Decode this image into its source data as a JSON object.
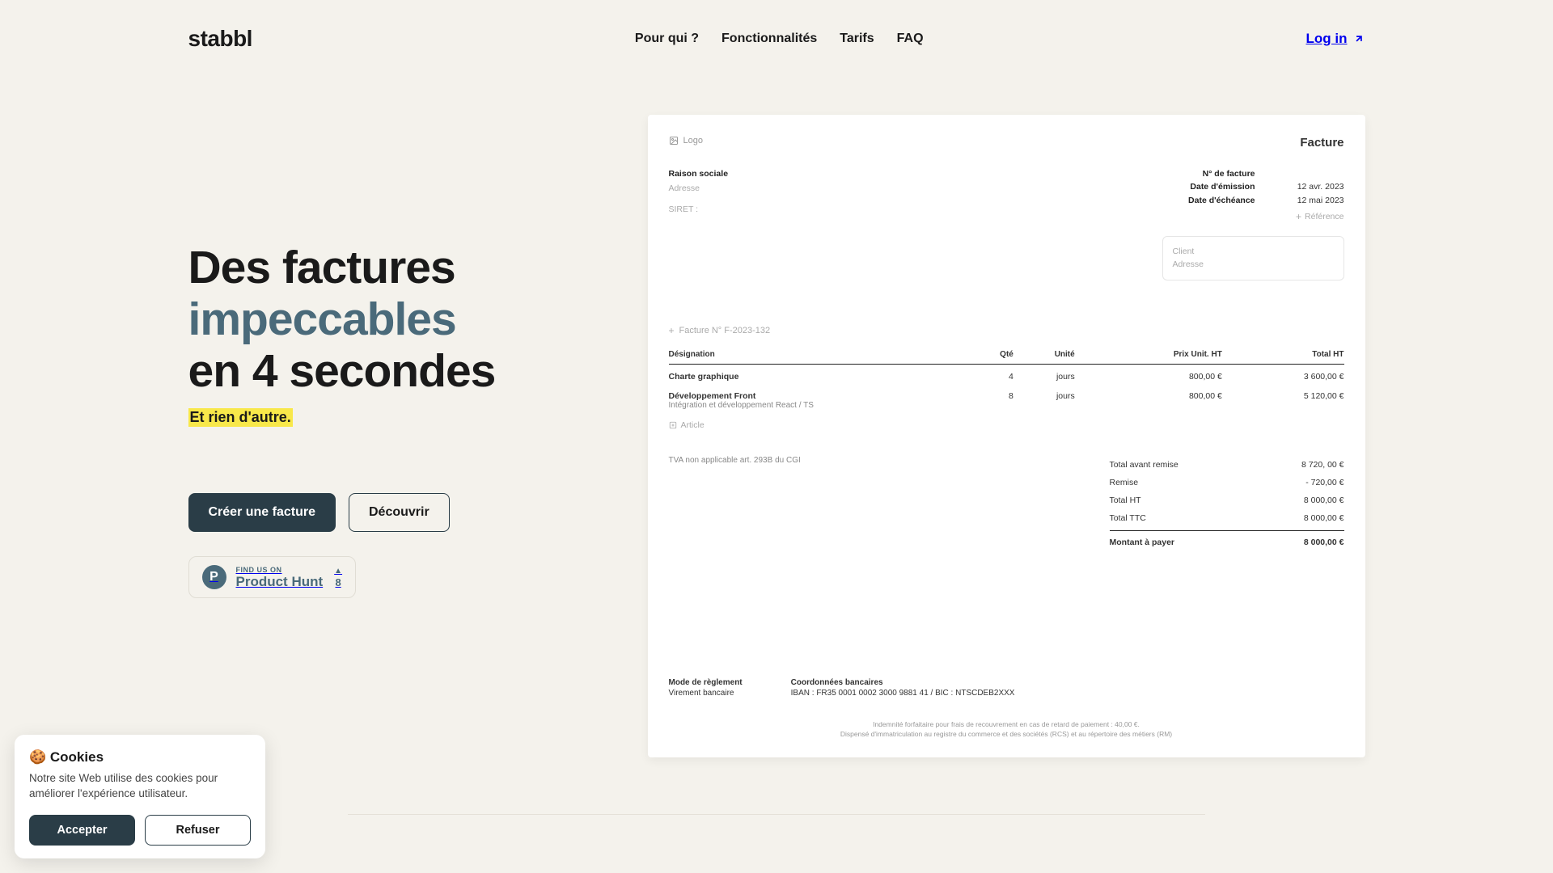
{
  "brand": "stabbl",
  "nav": {
    "pour_qui": "Pour qui ?",
    "fonctionnalites": "Fonctionnalités",
    "tarifs": "Tarifs",
    "faq": "FAQ"
  },
  "login": "Log in",
  "hero": {
    "line1": "Des factures",
    "line2": "impeccables",
    "line3": "en 4 secondes",
    "tagline": "Et rien d'autre.",
    "cta_primary": "Créer une facture",
    "cta_secondary": "Découvrir"
  },
  "ph": {
    "find_us": "FIND US ON",
    "name": "Product Hunt",
    "count": "8"
  },
  "invoice": {
    "logo_label": "Logo",
    "title": "Facture",
    "from": {
      "company": "Raison sociale",
      "address": "Adresse",
      "siret": "SIRET :"
    },
    "dates": {
      "num_label": "N° de facture",
      "issue_label": "Date d'émission",
      "issue_val": "12 avr. 2023",
      "due_label": "Date d'échéance",
      "due_val": "12 mai 2023",
      "ref": "Référence"
    },
    "client": {
      "label": "Client",
      "address": "Adresse"
    },
    "number": "Facture N° F-2023-132",
    "cols": {
      "design": "Désignation",
      "qty": "Qté",
      "unit": "Unité",
      "pu": "Prix Unit. HT",
      "total": "Total HT"
    },
    "rows": [
      {
        "name": "Charte graphique",
        "sub": "",
        "qty": "4",
        "unit": "jours",
        "pu": "800,00 €",
        "total": "3 600,00 €"
      },
      {
        "name": "Développement Front",
        "sub": "Intégration et développement React / TS",
        "qty": "8",
        "unit": "jours",
        "pu": "800,00 €",
        "total": "5 120,00 €"
      }
    ],
    "add_article": "Article",
    "tva_note": "TVA non applicable art. 293B du CGI",
    "totals": {
      "avant_remise_lbl": "Total avant remise",
      "avant_remise_val": "8 720, 00 €",
      "remise_lbl": "Remise",
      "remise_val": "- 720,00 €",
      "ht_lbl": "Total HT",
      "ht_val": "8 000,00 €",
      "ttc_lbl": "Total TTC",
      "ttc_val": "8 000,00 €",
      "due_lbl": "Montant à payer",
      "due_val": "8 000,00 €"
    },
    "payment": {
      "mode_lbl": "Mode de règlement",
      "mode_val": "Virement bancaire",
      "bank_lbl": "Coordonnées bancaires",
      "bank_val": "IBAN : FR35 0001 0002 3000 9881 41 / BIC : NTSCDEB2XXX"
    },
    "legal1": "Indemnité forfaitaire pour frais de recouvrement en cas de retard de paiement : 40,00 €.",
    "legal2": "Dispensé d'immatriculation au registre du commerce et des sociétés (RCS) et au répertoire des métiers (RM)"
  },
  "cookie": {
    "title": "🍪 Cookies",
    "body": "Notre site Web utilise des cookies pour améliorer l'expérience utilisateur.",
    "accept": "Accepter",
    "refuse": "Refuser"
  }
}
